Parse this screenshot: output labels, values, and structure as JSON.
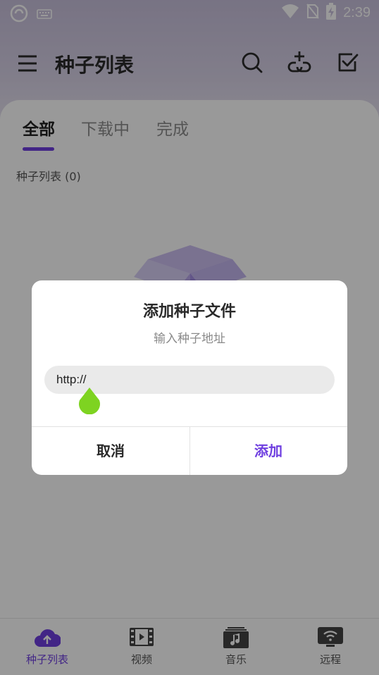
{
  "status_bar": {
    "time": "2:39",
    "icons": [
      "app-logo-icon",
      "keyboard-icon",
      "wifi-icon",
      "no-sim-icon",
      "battery-charging-icon"
    ]
  },
  "app_bar": {
    "title": "种子列表",
    "actions": [
      "search-icon",
      "add-link-icon",
      "select-check-icon"
    ]
  },
  "tabs": [
    {
      "label": "全部",
      "active": true
    },
    {
      "label": "下载中",
      "active": false
    },
    {
      "label": "完成",
      "active": false
    }
  ],
  "list": {
    "header": "种子列表 (0)"
  },
  "dialog": {
    "title": "添加种子文件",
    "subtitle": "输入种子地址",
    "input_value": "http://",
    "cancel_label": "取消",
    "confirm_label": "添加"
  },
  "bottom_nav": [
    {
      "label": "种子列表",
      "icon": "cloud-upload-icon",
      "active": true
    },
    {
      "label": "视频",
      "icon": "film-icon",
      "active": false
    },
    {
      "label": "音乐",
      "icon": "music-icon",
      "active": false
    },
    {
      "label": "远程",
      "icon": "remote-wifi-icon",
      "active": false
    }
  ],
  "colors": {
    "accent": "#6f3fe0",
    "cursor_handle": "#7ed321"
  }
}
